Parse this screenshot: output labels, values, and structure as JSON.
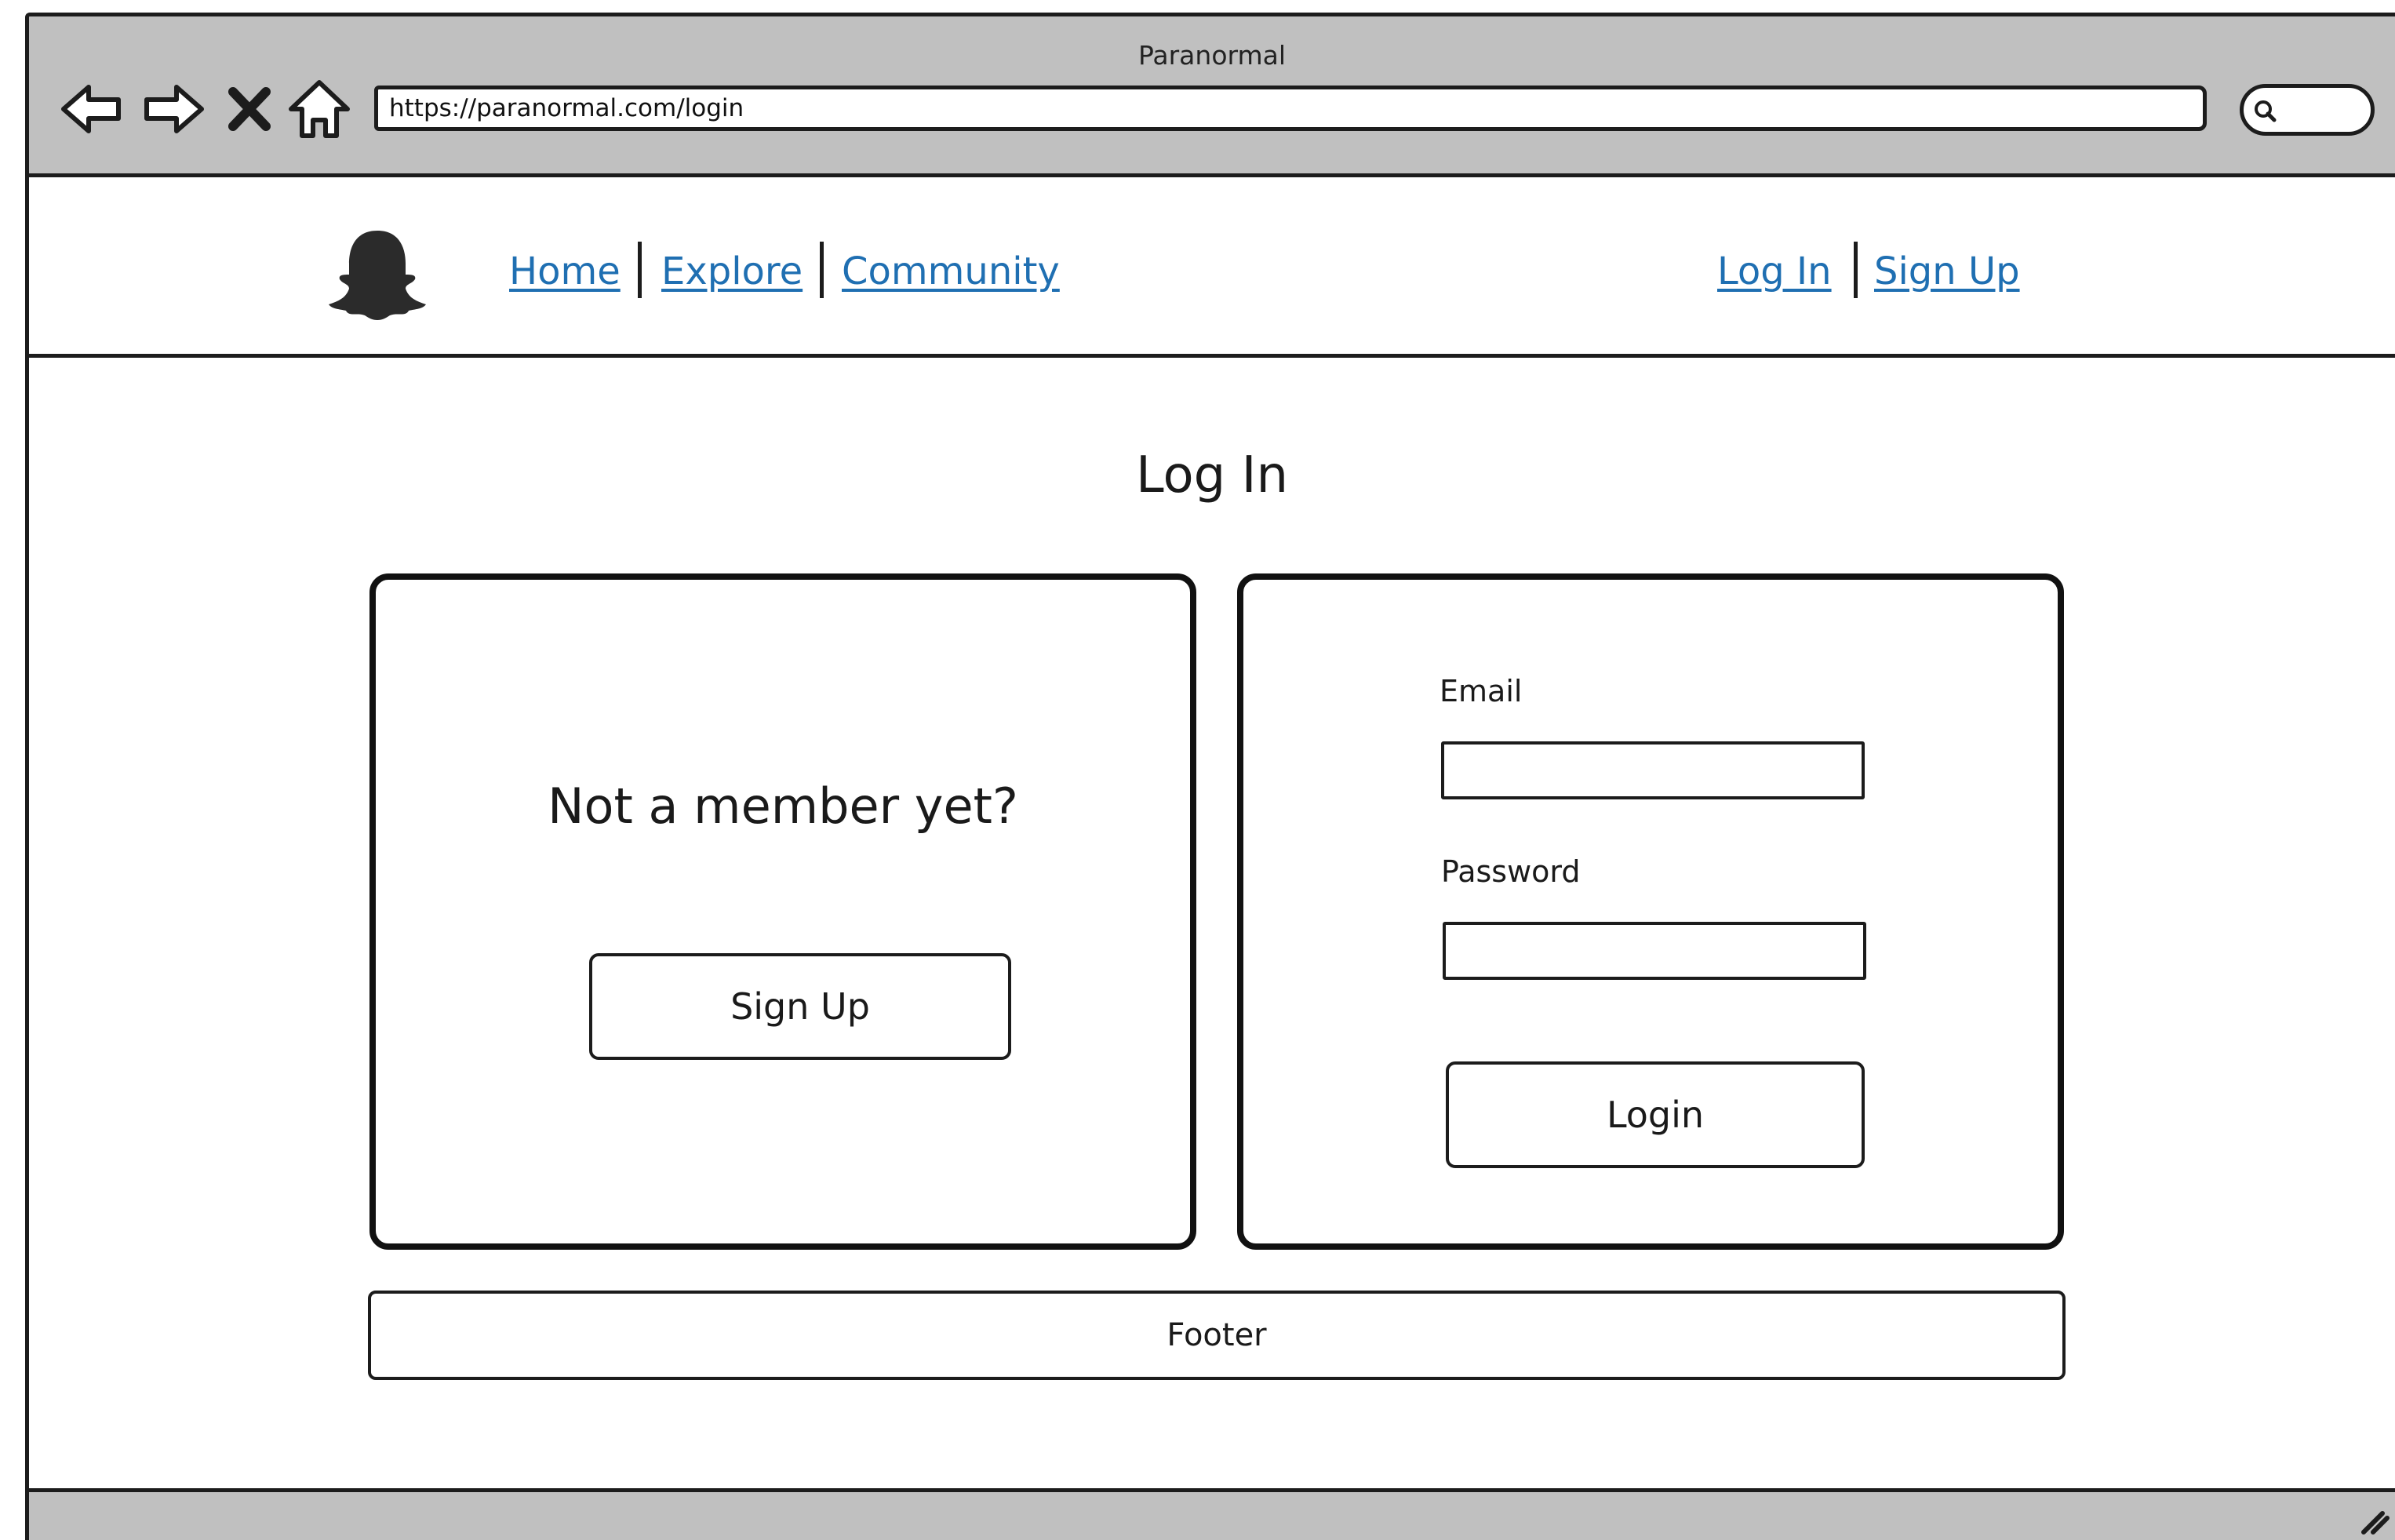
{
  "browser": {
    "window_title": "Paranormal",
    "url": "https://paranormal.com/login",
    "icons": {
      "back": "back-arrow-icon",
      "forward": "forward-arrow-icon",
      "stop": "close-icon",
      "home": "home-icon",
      "search": "search-icon",
      "resize": "resize-grip-icon"
    }
  },
  "header": {
    "logo_icon": "ghost-logo-icon",
    "nav": [
      {
        "label": "Home"
      },
      {
        "label": "Explore"
      },
      {
        "label": "Community"
      }
    ],
    "auth": {
      "login_label": "Log In",
      "signup_label": "Sign Up"
    },
    "link_color": "#1f6fb2"
  },
  "main": {
    "title": "Log In",
    "signup_panel": {
      "prompt": "Not a member yet?",
      "button_label": "Sign Up"
    },
    "login_panel": {
      "email_label": "Email",
      "email_value": "",
      "password_label": "Password",
      "password_value": "",
      "button_label": "Login"
    }
  },
  "footer": {
    "label": "Footer"
  },
  "colors": {
    "chrome": "#c0c0c0",
    "stroke": "#1c1c1c"
  }
}
